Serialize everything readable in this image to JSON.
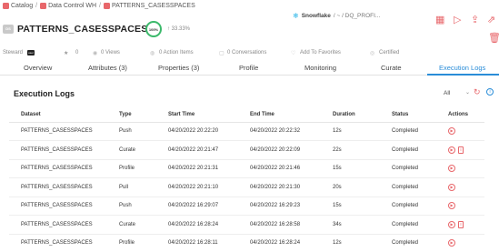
{
  "breadcrumb": {
    "items": [
      {
        "label": "Catalog"
      },
      {
        "label": "Data Control WH"
      },
      {
        "label": "PATTERNS_CASESSPACES"
      }
    ],
    "separator": "/"
  },
  "asset": {
    "icon_text": "DS",
    "title": "PATTERNS_CASESSPACES",
    "score": "100%",
    "score_trend": "↑ 33.33%",
    "source_name": "Snowflake",
    "source_path": "/ ~ / DQ_PROFI..."
  },
  "meta": {
    "steward_label": "Steward",
    "steward_avatar": "user",
    "stars": "0",
    "views": "0 Views",
    "action_items": "0 Action Items",
    "conversations": "0 Conversations",
    "favorites": "Add To Favorites",
    "certified": "Certified"
  },
  "tabs": [
    {
      "label": "Overview"
    },
    {
      "label": "Attributes (3)"
    },
    {
      "label": "Properties (3)"
    },
    {
      "label": "Profile"
    },
    {
      "label": "Monitoring"
    },
    {
      "label": "Curate"
    },
    {
      "label": "Execution Logs",
      "active": true
    }
  ],
  "logs": {
    "title": "Execution Logs",
    "filter_value": "All",
    "columns": [
      "Dataset",
      "Type",
      "Start Time",
      "End Time",
      "Duration",
      "Status",
      "Actions"
    ],
    "rows": [
      {
        "dataset": "PATTERNS_CASESSPACES",
        "type": "Push",
        "start": "04/20/2022 20:22:20",
        "end": "04/20/2022 20:22:32",
        "duration": "12s",
        "status": "Completed",
        "has_report": false
      },
      {
        "dataset": "PATTERNS_CASESSPACES",
        "type": "Curate",
        "start": "04/20/2022 20:21:47",
        "end": "04/20/2022 20:22:09",
        "duration": "22s",
        "status": "Completed",
        "has_report": true
      },
      {
        "dataset": "PATTERNS_CASESSPACES",
        "type": "Profile",
        "start": "04/20/2022 20:21:31",
        "end": "04/20/2022 20:21:46",
        "duration": "15s",
        "status": "Completed",
        "has_report": false
      },
      {
        "dataset": "PATTERNS_CASESSPACES",
        "type": "Pull",
        "start": "04/20/2022 20:21:10",
        "end": "04/20/2022 20:21:30",
        "duration": "20s",
        "status": "Completed",
        "has_report": false
      },
      {
        "dataset": "PATTERNS_CASESSPACES",
        "type": "Push",
        "start": "04/20/2022 16:29:07",
        "end": "04/20/2022 16:29:23",
        "duration": "15s",
        "status": "Completed",
        "has_report": false
      },
      {
        "dataset": "PATTERNS_CASESSPACES",
        "type": "Curate",
        "start": "04/20/2022 16:28:24",
        "end": "04/20/2022 16:28:58",
        "duration": "34s",
        "status": "Completed",
        "has_report": true
      },
      {
        "dataset": "PATTERNS_CASESSPACES",
        "type": "Profile",
        "start": "04/20/2022 16:28:11",
        "end": "04/20/2022 16:28:24",
        "duration": "12s",
        "status": "Completed",
        "has_report": false
      }
    ]
  },
  "icons": {
    "crumb": "catalog-icon",
    "source": "snowflake-icon",
    "row_run": "play-circle-icon",
    "row_report": "report-icon"
  },
  "colors": {
    "accent": "#e8676b",
    "active_tab": "#2a8dd8",
    "score_ring": "#3cb96b"
  }
}
